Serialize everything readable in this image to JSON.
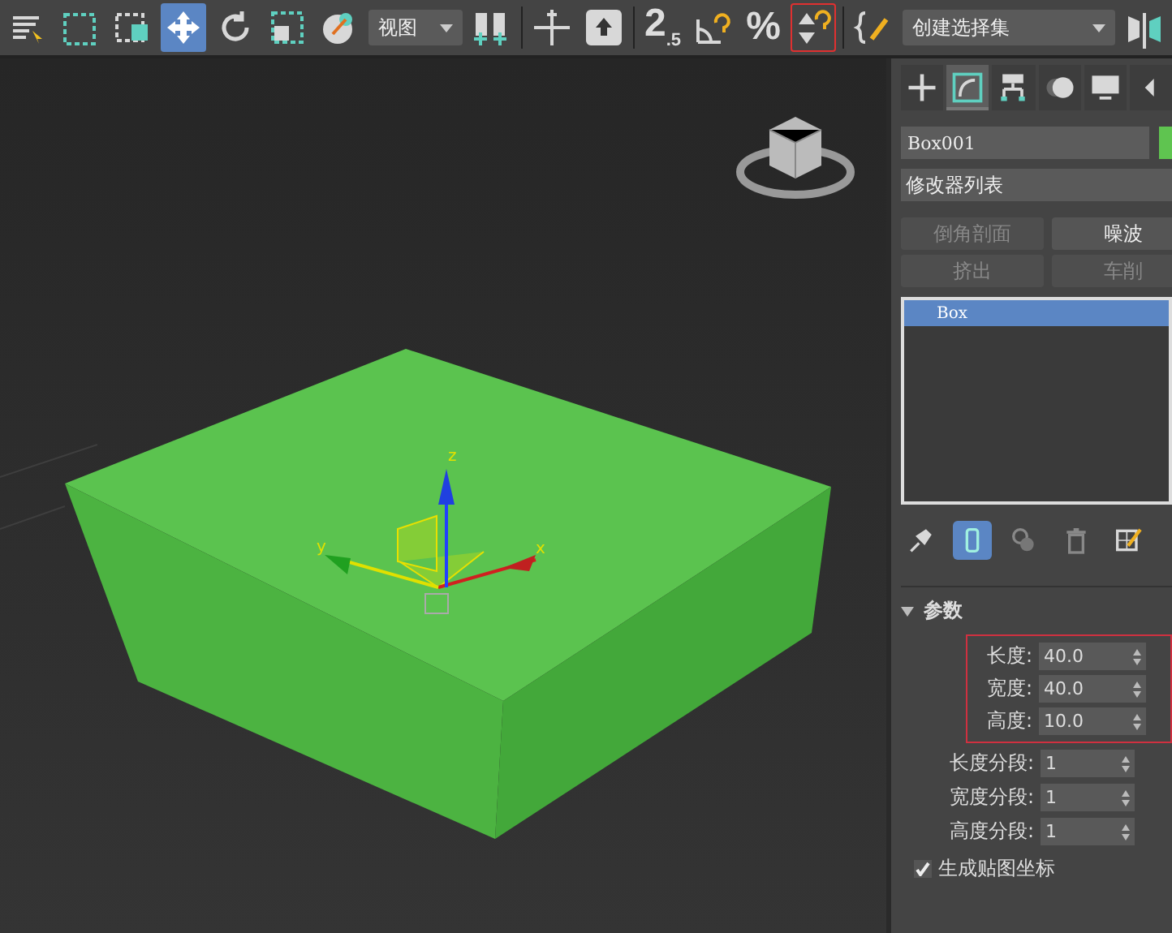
{
  "toolbar": {
    "tools": [
      {
        "kind": "select-list",
        "selected": false,
        "highlighted": false
      },
      {
        "kind": "rect-select",
        "selected": false,
        "highlighted": false
      },
      {
        "kind": "window-crossing",
        "selected": false,
        "highlighted": false
      },
      {
        "kind": "move",
        "selected": true,
        "highlighted": false
      },
      {
        "kind": "rotate",
        "selected": false,
        "highlighted": false
      },
      {
        "kind": "scale",
        "selected": false,
        "highlighted": false
      },
      {
        "kind": "pivot",
        "selected": false,
        "highlighted": false
      },
      {
        "kind": "dropdown",
        "text": "视图"
      },
      {
        "kind": "pivot-center",
        "selected": false,
        "highlighted": false
      },
      {
        "kind": "separator"
      },
      {
        "kind": "manipulate",
        "selected": false,
        "highlighted": false
      },
      {
        "kind": "keyboard",
        "selected": false,
        "highlighted": false
      },
      {
        "kind": "separator"
      },
      {
        "kind": "snap",
        "text": "2",
        "sub": ".5",
        "selected": false,
        "highlighted": false
      },
      {
        "kind": "angle-snap",
        "selected": false,
        "highlighted": false
      },
      {
        "kind": "percent-snap",
        "text": "%",
        "selected": false,
        "highlighted": false
      },
      {
        "kind": "spinner-snap",
        "selected": false,
        "highlighted": true
      },
      {
        "kind": "separator"
      },
      {
        "kind": "edit-sets",
        "selected": false,
        "highlighted": false
      },
      {
        "kind": "wide-dropdown",
        "text": "创建选择集"
      },
      {
        "kind": "mirror",
        "selected": false,
        "highlighted": false
      }
    ]
  },
  "viewport": {
    "gizmo": {
      "z_label": "z",
      "y_label": "y",
      "x_label": "x"
    }
  },
  "command_panel": {
    "tabs": [
      {
        "kind": "create",
        "selected": false
      },
      {
        "kind": "modify",
        "selected": true
      },
      {
        "kind": "hierarchy",
        "selected": false
      },
      {
        "kind": "motion",
        "selected": false
      },
      {
        "kind": "display",
        "selected": false
      },
      {
        "kind": "utilities",
        "selected": false
      }
    ],
    "object_name": "Box001",
    "modifier_list": "修改器列表",
    "modifier_buttons": [
      {
        "label": "倒角剖面",
        "disabled": true
      },
      {
        "label": "噪波",
        "disabled": false
      },
      {
        "label": "挤出",
        "disabled": true
      },
      {
        "label": "车削",
        "disabled": true
      }
    ],
    "stack": [
      {
        "label": "Box",
        "selected": true
      }
    ],
    "stack_tools": [
      {
        "kind": "pin",
        "selected": false
      },
      {
        "kind": "end-result",
        "selected": true
      },
      {
        "kind": "make-unique",
        "selected": false
      },
      {
        "kind": "remove",
        "selected": false
      },
      {
        "kind": "configure",
        "selected": false
      }
    ],
    "rollout": {
      "title": "参数",
      "expanded": true,
      "params": [
        {
          "label": "长度:",
          "value": "40.0",
          "highlighted": true
        },
        {
          "label": "宽度:",
          "value": "40.0",
          "highlighted": true
        },
        {
          "label": "高度:",
          "value": "10.0",
          "highlighted": true
        },
        {
          "label": "长度分段:",
          "value": "1",
          "highlighted": false
        },
        {
          "label": "宽度分段:",
          "value": "1",
          "highlighted": false
        },
        {
          "label": "高度分段:",
          "value": "1",
          "highlighted": false
        }
      ],
      "checkboxes": [
        {
          "label": "生成贴图坐标",
          "checked": true
        }
      ]
    }
  }
}
